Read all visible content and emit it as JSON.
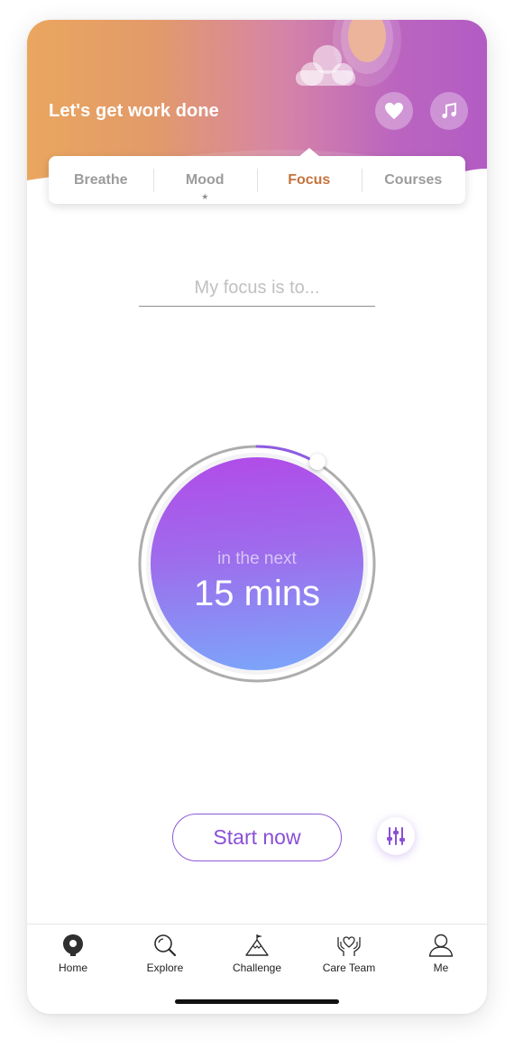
{
  "header": {
    "title": "Let's get work done",
    "favorite_icon": "heart-icon",
    "music_icon": "music-note-icon"
  },
  "tabs": [
    {
      "label": "Breathe",
      "active": false
    },
    {
      "label": "Mood",
      "active": false,
      "badge": "★"
    },
    {
      "label": "Focus",
      "active": true
    },
    {
      "label": "Courses",
      "active": false
    }
  ],
  "focus": {
    "placeholder": "My focus is to...",
    "value": ""
  },
  "timer": {
    "caption": "in the next",
    "value": "15 mins",
    "progress_fraction": 0.08
  },
  "actions": {
    "start_label": "Start now",
    "settings_icon": "sliders-icon"
  },
  "nav": [
    {
      "label": "Home",
      "icon": "home-icon"
    },
    {
      "label": "Explore",
      "icon": "search-icon"
    },
    {
      "label": "Challenge",
      "icon": "mountain-flag-icon"
    },
    {
      "label": "Care Team",
      "icon": "heart-hands-icon"
    },
    {
      "label": "Me",
      "icon": "user-icon"
    }
  ],
  "colors": {
    "accent": "#c4743f",
    "primary": "#8a4fd6",
    "header_start": "#eaa65f",
    "header_end": "#b25cc4"
  }
}
